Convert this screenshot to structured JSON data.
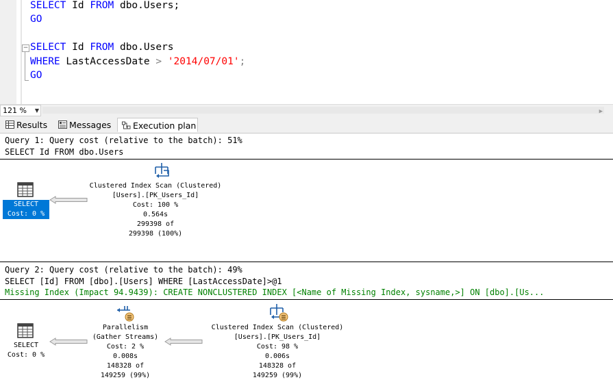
{
  "editor": {
    "line1": {
      "kw1": "SELECT",
      "text1": " Id ",
      "kw2": "FROM",
      "text2": " dbo.Users;"
    },
    "line2": {
      "kw": "GO"
    },
    "line4": {
      "kw1": "SELECT",
      "text1": " Id ",
      "kw2": "FROM",
      "text2": " dbo.Users"
    },
    "line5": {
      "kw": "WHERE",
      "text1": " LastAccessDate ",
      "op": ">",
      "text2": " ",
      "str": "'2014/07/01'",
      "op2": ";"
    },
    "line6": {
      "kw": "GO"
    },
    "fold_glyph": "−"
  },
  "zoom": {
    "value": "121 %"
  },
  "tabs": [
    {
      "label": "Results",
      "icon": "grid-icon"
    },
    {
      "label": "Messages",
      "icon": "messages-icon"
    },
    {
      "label": "Execution plan",
      "icon": "execution-plan-icon"
    }
  ],
  "query1": {
    "header": "Query 1: Query cost (relative to the batch): 51%",
    "sql": "SELECT Id FROM dbo.Users",
    "select_node": {
      "name": "SELECT",
      "cost": "Cost: 0 %"
    },
    "scan_node": {
      "name": "Clustered Index Scan (Clustered)",
      "object": "[Users].[PK_Users_Id]",
      "cost": "Cost: 100 %",
      "time": "0.564s",
      "rows1": "299398 of",
      "rows2": "299398 (100%)"
    }
  },
  "query2": {
    "header": "Query 2: Query cost (relative to the batch): 49%",
    "sql": "SELECT [Id] FROM [dbo].[Users] WHERE [LastAccessDate]>@1",
    "missing_index": "Missing Index (Impact 94.9439): CREATE NONCLUSTERED INDEX [<Name of Missing Index, sysname,>] ON [dbo].[Us...",
    "select_node": {
      "name": "SELECT",
      "cost": "Cost: 0 %"
    },
    "parallelism_node": {
      "name": "Parallelism",
      "sub": "(Gather Streams)",
      "cost": "Cost: 2 %",
      "time": "0.008s",
      "rows1": "148328 of",
      "rows2": "149259 (99%)"
    },
    "scan_node": {
      "name": "Clustered Index Scan (Clustered)",
      "object": "[Users].[PK_Users_Id]",
      "cost": "Cost: 98 %",
      "time": "0.006s",
      "rows1": "148328 of",
      "rows2": "149259 (99%)"
    }
  },
  "colors": {
    "keyword": "#0000ff",
    "string": "#ff0000",
    "missing_index": "#008000",
    "selection": "#0078d7"
  }
}
